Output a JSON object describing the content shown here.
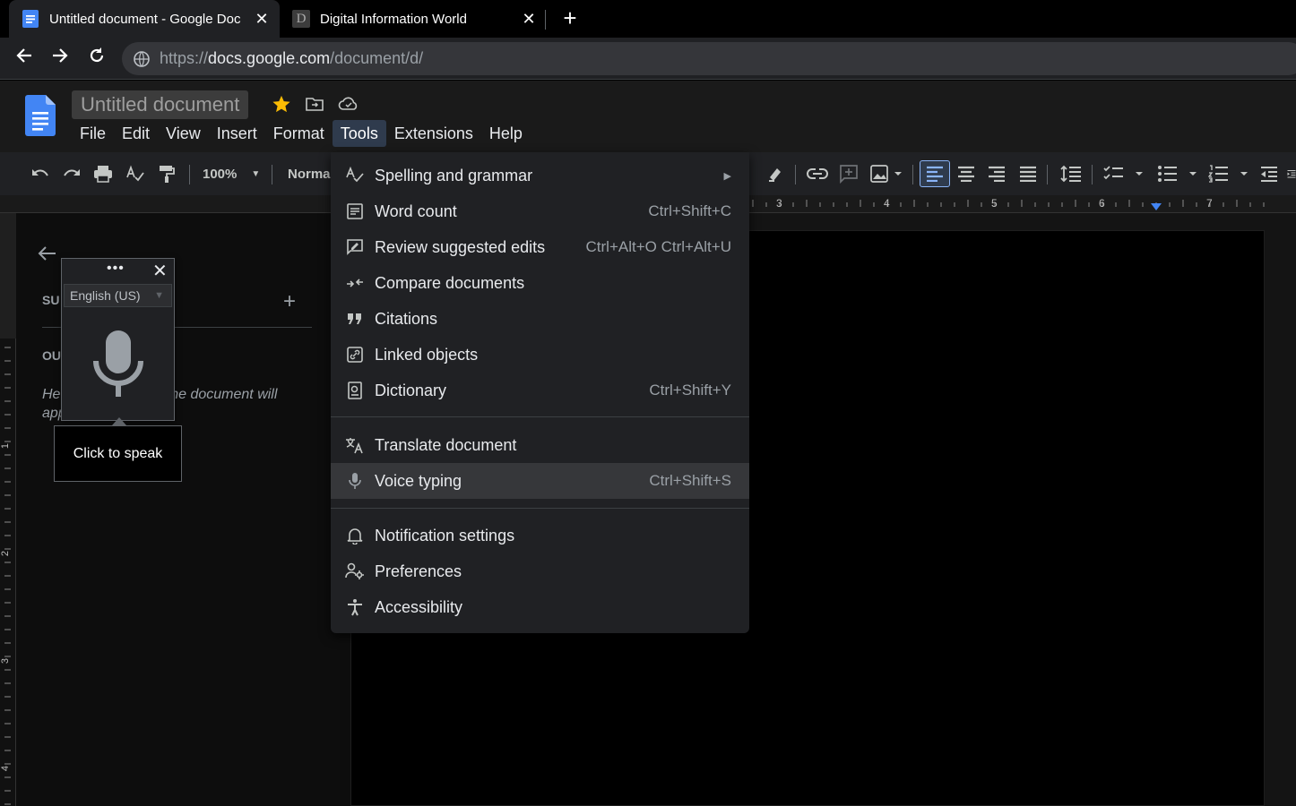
{
  "browser": {
    "tabs": [
      {
        "title": "Untitled document - Google Doc",
        "close": "✕"
      },
      {
        "title": "Digital Information World",
        "favicon_letter": "D",
        "close": "✕"
      }
    ],
    "new_tab": "+",
    "url_prefix": "https://",
    "url_domain": "docs.google.com",
    "url_path": "/document/d/"
  },
  "docs": {
    "title": "Untitled document",
    "menu": [
      "File",
      "Edit",
      "View",
      "Insert",
      "Format",
      "Tools",
      "Extensions",
      "Help"
    ],
    "open_menu": "Tools",
    "zoom": "100%",
    "style": "Normal"
  },
  "ruler": {
    "marks": [
      "3",
      "4",
      "5",
      "6",
      "7"
    ]
  },
  "vruler": {
    "marks": [
      "1",
      "2",
      "3",
      "4"
    ]
  },
  "outline": {
    "summary_label": "SU",
    "outline_label": "OU",
    "hint_start": "He",
    "hint_mid": "o the document will",
    "hint_end": "app"
  },
  "voice": {
    "dots": "•••",
    "close": "✕",
    "language": "English (US)",
    "tooltip": "Click to speak"
  },
  "tools_menu": {
    "items": [
      {
        "label": "Spelling and grammar",
        "shortcut": "",
        "submenu": "▶",
        "icon": "spellcheck-icon"
      },
      {
        "label": "Word count",
        "shortcut": "Ctrl+Shift+C",
        "icon": "word-count-icon"
      },
      {
        "label": "Review suggested edits",
        "shortcut": "Ctrl+Alt+O Ctrl+Alt+U",
        "icon": "review-edits-icon"
      },
      {
        "label": "Compare documents",
        "shortcut": "",
        "icon": "compare-icon"
      },
      {
        "label": "Citations",
        "shortcut": "",
        "icon": "citations-icon"
      },
      {
        "label": "Linked objects",
        "shortcut": "",
        "icon": "linked-objects-icon"
      },
      {
        "label": "Dictionary",
        "shortcut": "Ctrl+Shift+Y",
        "icon": "dictionary-icon"
      },
      {
        "label": "Translate document",
        "shortcut": "",
        "icon": "translate-icon"
      },
      {
        "label": "Voice typing",
        "shortcut": "Ctrl+Shift+S",
        "icon": "microphone-icon",
        "highlighted": true
      },
      {
        "label": "Notification settings",
        "shortcut": "",
        "icon": "bell-icon"
      },
      {
        "label": "Preferences",
        "shortcut": "",
        "icon": "preferences-icon"
      },
      {
        "label": "Accessibility",
        "shortcut": "",
        "icon": "accessibility-icon"
      }
    ]
  },
  "colors": {
    "accent": "#8ab4f8",
    "star": "#fbbc04",
    "docs_blue": "#4285f4"
  }
}
